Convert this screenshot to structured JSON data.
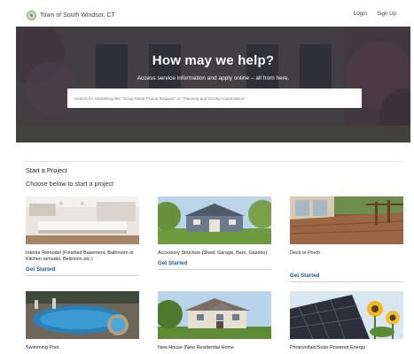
{
  "header": {
    "site_name": "Town of South Windsor, CT",
    "login_label": "Login",
    "signup_label": "Sign Up"
  },
  "hero": {
    "title": "How may we help?",
    "subtitle": "Access service information and apply online – all from here.",
    "search_placeholder": "Search for something like \"Scrap Metal Pickup Request\" or \"Planning and Zoning Commission\""
  },
  "projects": {
    "section_title": "Start a Project",
    "section_subtitle": "Choose below to start a project",
    "cta_label": "Get Started",
    "cards": [
      {
        "label": "Interior Remodel (Finished Basement, Bathroom or Kitchen remodel, Bedroom etc.)",
        "image": "kitchen-photo"
      },
      {
        "label": "Accessory Structure (Shed, Garage, Barn, Gazebo)",
        "image": "shed-photo"
      },
      {
        "label": "Deck or Porch",
        "image": "deck-photo"
      },
      {
        "label": "Swimming Pool",
        "image": "pool-photo"
      },
      {
        "label": "New House (New Residential Home",
        "image": "house-photo"
      },
      {
        "label": "Photovoltaic/Solar-Powered Energy",
        "image": "solar-photo"
      }
    ]
  },
  "colors": {
    "link": "#1f5aa5",
    "hero_overlay": "#5d5d66"
  }
}
